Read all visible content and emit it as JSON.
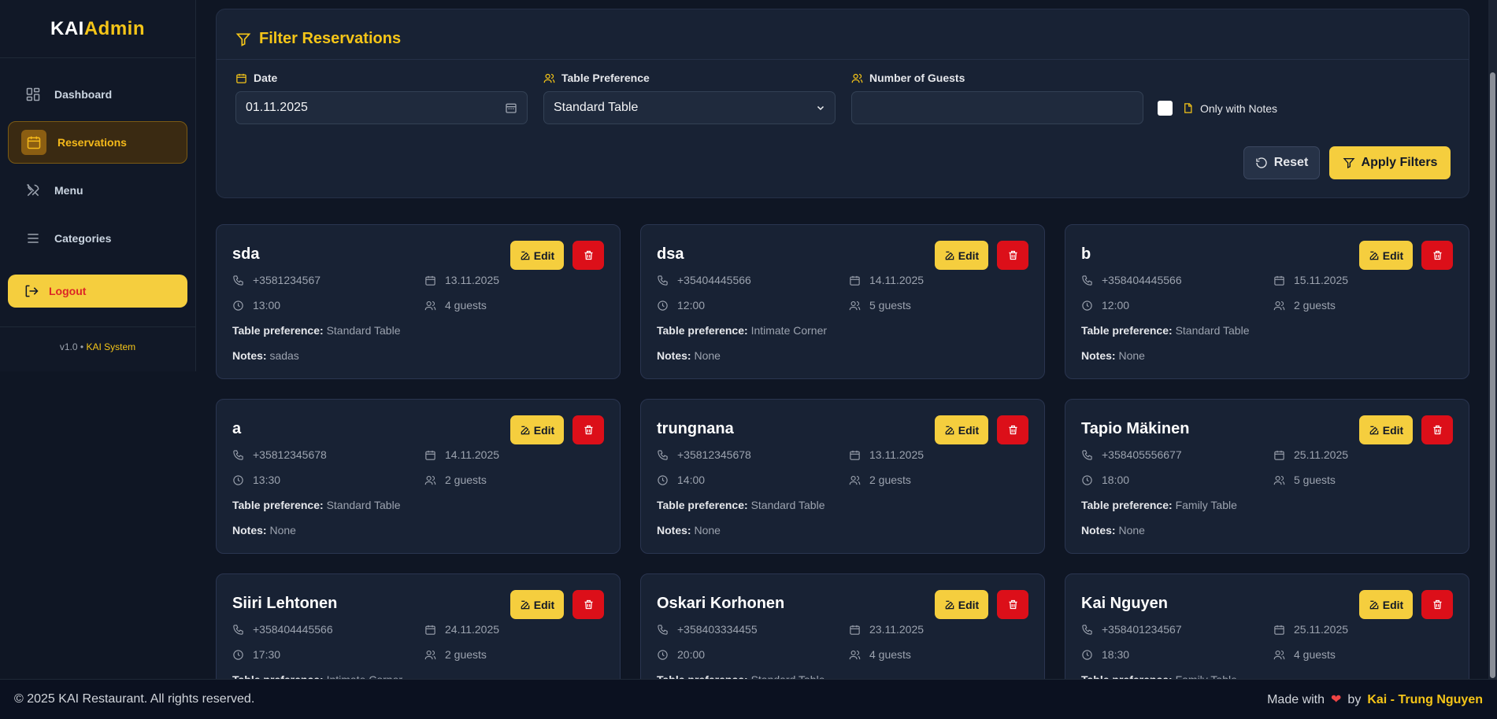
{
  "brand": {
    "part1": "KAI",
    "part2": "Admin"
  },
  "sidebar": {
    "items": [
      {
        "label": "Dashboard",
        "icon": "dashboard-icon"
      },
      {
        "label": "Reservations",
        "icon": "calendar-icon",
        "active": true
      },
      {
        "label": "Menu",
        "icon": "utensils-icon"
      },
      {
        "label": "Categories",
        "icon": "list-icon"
      }
    ],
    "logout_label": "Logout",
    "version": "v1.0 •",
    "system": "KAI System"
  },
  "filter": {
    "title": "Filter Reservations",
    "date_label": "Date",
    "date_value": "01.11.2025",
    "table_label": "Table Preference",
    "table_value": "Standard Table",
    "guests_label": "Number of Guests",
    "guests_value": "",
    "notes_label": "Only with Notes",
    "reset_label": "Reset",
    "apply_label": "Apply Filters"
  },
  "labels": {
    "edit": "Edit",
    "table_pref": "Table preference:",
    "notes": "Notes:"
  },
  "reservations": [
    {
      "name": "sda",
      "phone": "+3581234567",
      "date": "13.11.2025",
      "time": "13:00",
      "guests": "4 guests",
      "table": "Standard Table",
      "notes": "sadas"
    },
    {
      "name": "dsa",
      "phone": "+35404445566",
      "date": "14.11.2025",
      "time": "12:00",
      "guests": "5 guests",
      "table": "Intimate Corner",
      "notes": "None"
    },
    {
      "name": "b",
      "phone": "+358404445566",
      "date": "15.11.2025",
      "time": "12:00",
      "guests": "2 guests",
      "table": "Standard Table",
      "notes": "None"
    },
    {
      "name": "a",
      "phone": "+35812345678",
      "date": "14.11.2025",
      "time": "13:30",
      "guests": "2 guests",
      "table": "Standard Table",
      "notes": "None"
    },
    {
      "name": "trungnana",
      "phone": "+35812345678",
      "date": "13.11.2025",
      "time": "14:00",
      "guests": "2 guests",
      "table": "Standard Table",
      "notes": "None"
    },
    {
      "name": "Tapio Mäkinen",
      "phone": "+358405556677",
      "date": "25.11.2025",
      "time": "18:00",
      "guests": "5 guests",
      "table": "Family Table",
      "notes": "None"
    },
    {
      "name": "Siiri Lehtonen",
      "phone": "+358404445566",
      "date": "24.11.2025",
      "time": "17:30",
      "guests": "2 guests",
      "table": "Intimate Corner",
      "notes": ""
    },
    {
      "name": "Oskari Korhonen",
      "phone": "+358403334455",
      "date": "23.11.2025",
      "time": "20:00",
      "guests": "4 guests",
      "table": "Standard Table",
      "notes": ""
    },
    {
      "name": "Kai Nguyen",
      "phone": "+358401234567",
      "date": "25.11.2025",
      "time": "18:30",
      "guests": "4 guests",
      "table": "Family Table",
      "notes": ""
    }
  ],
  "footer": {
    "copyright": "© 2025 KAI Restaurant. All rights reserved.",
    "made_with": "Made with",
    "by": "by",
    "author": "Kai - Trung Nguyen"
  }
}
